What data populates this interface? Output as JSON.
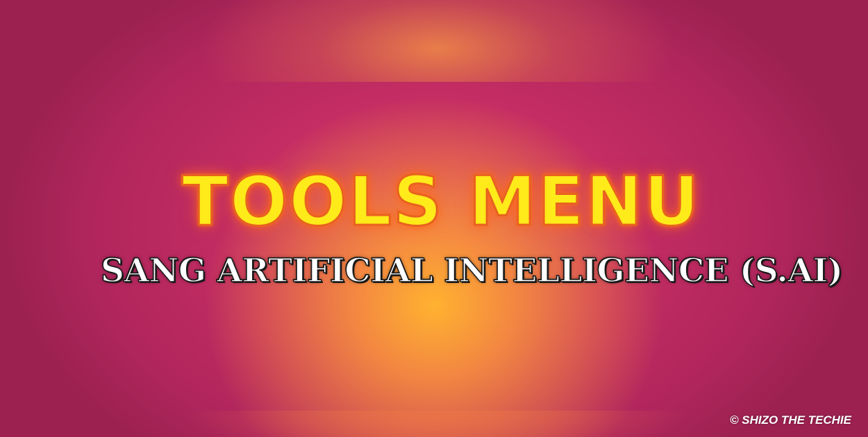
{
  "banner": {
    "title": "TOOLS MENU",
    "subtitle": "SANG ARTIFICIAL INTELLIGENCE (S.AI)",
    "watermark": "© SHIZO THE TECHIE"
  },
  "colors": {
    "background": "#b0265c",
    "glow_center": "#ffb230",
    "title_fill": "#ffea1a",
    "title_outline": "#e8621f",
    "subtitle_fill": "#ffffff",
    "subtitle_outline": "#1a1a1a",
    "watermark": "#ffffff"
  }
}
